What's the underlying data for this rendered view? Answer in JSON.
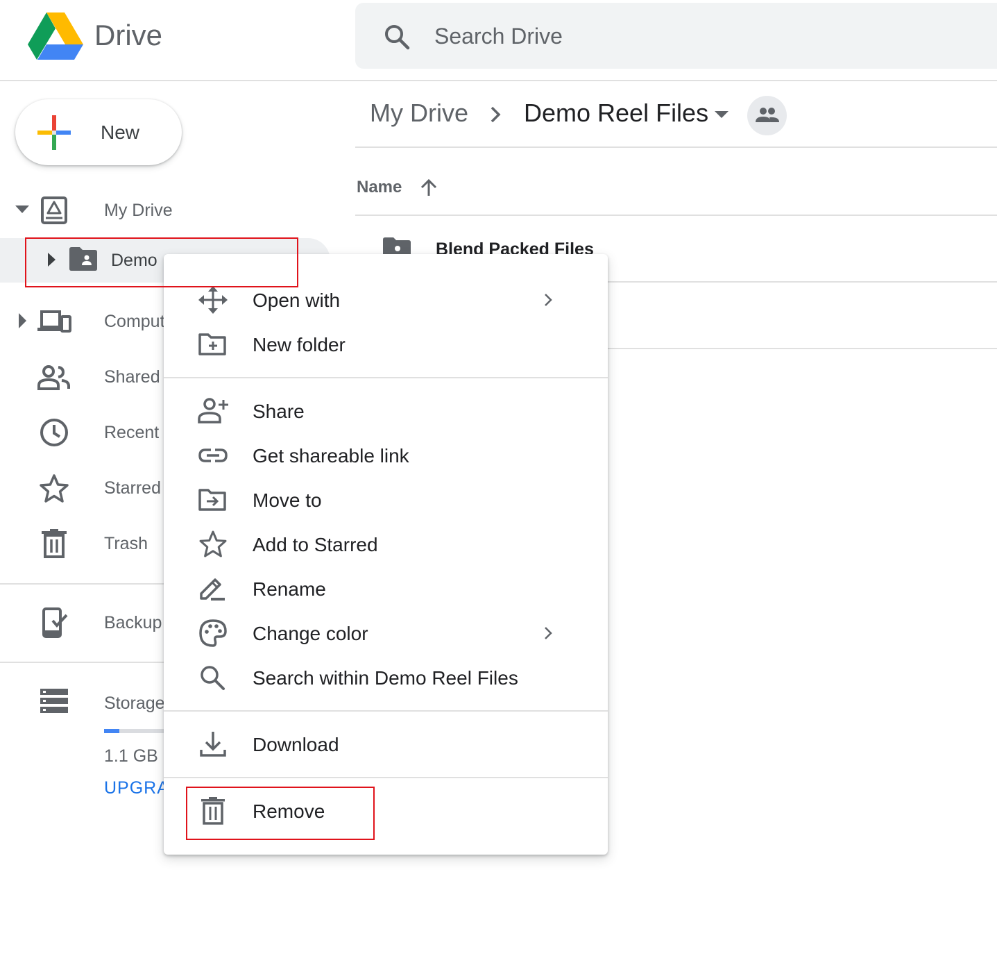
{
  "app": {
    "title": "Drive"
  },
  "search": {
    "placeholder": "Search Drive"
  },
  "sidebar": {
    "new_label": "New",
    "items": [
      {
        "label": "My Drive",
        "icon": "my-drive-icon"
      },
      {
        "label": "Demo Reel Files",
        "visible_text": "Demo",
        "icon": "shared-folder-icon"
      },
      {
        "label": "Computers",
        "visible_text": "Comput",
        "icon": "computer-icon"
      },
      {
        "label": "Shared with me",
        "visible_text": "Shared",
        "icon": "people-icon"
      },
      {
        "label": "Recent",
        "icon": "clock-icon"
      },
      {
        "label": "Starred",
        "icon": "star-icon"
      },
      {
        "label": "Trash",
        "icon": "trash-icon"
      },
      {
        "label": "Backups",
        "visible_text": "Backup",
        "icon": "backup-icon"
      },
      {
        "label": "Storage",
        "visible_text": "Storage",
        "icon": "storage-icon"
      }
    ],
    "storage_used_text": "1.1 GB",
    "storage_fraction": 0.25,
    "upgrade_label": "UPGRA"
  },
  "breadcrumb": {
    "root": "My Drive",
    "current": "Demo Reel Files"
  },
  "file_list": {
    "column_name": "Name",
    "sort": "ascending",
    "rows": [
      {
        "name": "Blend Packed Files",
        "icon": "shared-folder-icon"
      }
    ]
  },
  "context_menu": {
    "items": [
      {
        "label": "Open with",
        "icon": "move-arrows-icon",
        "submenu": true
      },
      {
        "label": "New folder",
        "icon": "new-folder-icon"
      },
      {
        "label": "Share",
        "icon": "add-person-icon"
      },
      {
        "label": "Get shareable link",
        "icon": "link-icon"
      },
      {
        "label": "Move to",
        "icon": "move-to-folder-icon"
      },
      {
        "label": "Add to Starred",
        "icon": "star-icon"
      },
      {
        "label": "Rename",
        "icon": "pencil-icon"
      },
      {
        "label": "Change color",
        "icon": "palette-icon",
        "submenu": true
      },
      {
        "label": "Search within Demo Reel Files",
        "icon": "search-icon"
      },
      {
        "label": "Download",
        "icon": "download-icon"
      },
      {
        "label": "Remove",
        "icon": "trash-icon"
      }
    ]
  },
  "colors": {
    "highlight": "#e0131b",
    "accent_blue": "#1a73e8",
    "text_gray": "#5f6368",
    "selected_bg": "#eef0f2"
  }
}
